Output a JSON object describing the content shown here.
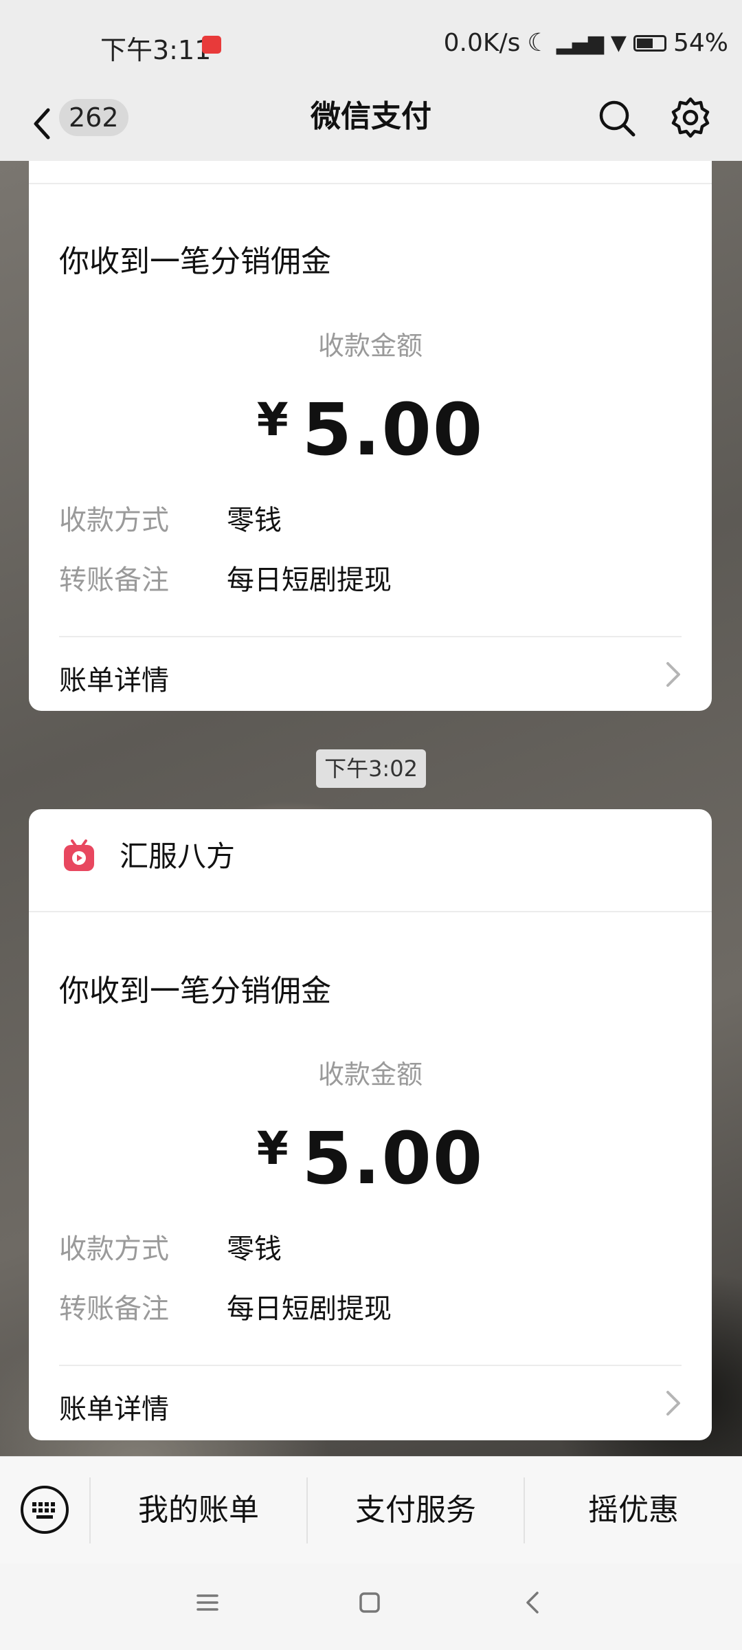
{
  "status_bar": {
    "time": "下午3:11",
    "right": "0.0K/s",
    "battery": "54%"
  },
  "nav": {
    "back_count": "262",
    "title": "微信支付"
  },
  "cards": [
    {
      "headline": "你收到一笔分销佣金",
      "amount_label": "收款金额",
      "currency": "¥",
      "amount": "5.00",
      "method_label": "收款方式",
      "method_value": "零钱",
      "note_label": "转账备注",
      "note_value": "每日短剧提现",
      "detail_label": "账单详情"
    },
    {
      "merchant": "汇服八方",
      "headline": "你收到一笔分销佣金",
      "amount_label": "收款金额",
      "currency": "¥",
      "amount": "5.00",
      "method_label": "收款方式",
      "method_value": "零钱",
      "note_label": "转账备注",
      "note_value": "每日短剧提现",
      "detail_label": "账单详情"
    }
  ],
  "timestamp": "下午3:02",
  "bottom_menu": {
    "items": [
      "我的账单",
      "支付服务",
      "摇优惠"
    ]
  },
  "colors": {
    "accent_logo": "#e8475f",
    "bar_bg": "#ededed"
  }
}
